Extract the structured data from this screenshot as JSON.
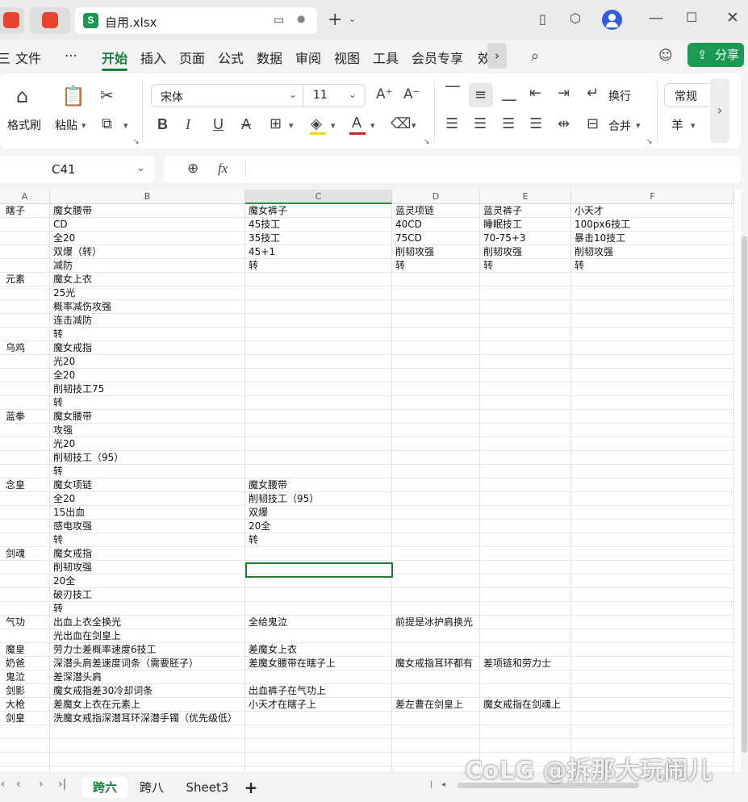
{
  "window": {
    "file_tab_title": "自用.xlsx",
    "sheet_icon_letter": "S"
  },
  "menu": {
    "items": [
      "三",
      "文件",
      "⋯",
      "开始",
      "插入",
      "页面",
      "公式",
      "数据",
      "审阅",
      "视图",
      "工具",
      "会员专享",
      "效"
    ],
    "active": "开始",
    "share_label": "分享"
  },
  "ribbon": {
    "format_painter": "格式刷",
    "paste": "粘贴",
    "font_name": "宋体",
    "font_size": "11",
    "wrap": "换行",
    "merge": "合并",
    "number_format": "常规",
    "currency": "羊"
  },
  "formula_bar": {
    "cell_ref": "C41",
    "fx": "fx",
    "content": ""
  },
  "grid": {
    "columns": [
      "A",
      "B",
      "C",
      "D",
      "E",
      "F"
    ],
    "selected_column": "C",
    "rows": [
      [
        "瞎子",
        "魔女腰带",
        "魔女裤子",
        "蓝灵项链",
        "蓝灵裤子",
        "小天才"
      ],
      [
        "",
        "CD",
        "45技工",
        "40CD",
        "睡眠技工",
        "100px6技工"
      ],
      [
        "",
        "全20",
        "35技工",
        "75CD",
        "70-75+3",
        "暴击10技工"
      ],
      [
        "",
        "双爆（转）",
        "45+1",
        "削韧攻强",
        "削韧攻强",
        "削韧攻强"
      ],
      [
        "",
        "减防",
        "转",
        "转",
        "转",
        "转"
      ],
      [
        "元素",
        "魔女上衣",
        "",
        "",
        "",
        ""
      ],
      [
        "",
        "25光",
        "",
        "",
        "",
        ""
      ],
      [
        "",
        "概率减伤攻强",
        "",
        "",
        "",
        ""
      ],
      [
        "",
        "连击减防",
        "",
        "",
        "",
        ""
      ],
      [
        "",
        "转",
        "",
        "",
        "",
        ""
      ],
      [
        "乌鸡",
        "魔女戒指",
        "",
        "",
        "",
        ""
      ],
      [
        "",
        "光20",
        "",
        "",
        "",
        ""
      ],
      [
        "",
        "全20",
        "",
        "",
        "",
        ""
      ],
      [
        "",
        "削韧技工75",
        "",
        "",
        "",
        ""
      ],
      [
        "",
        "转",
        "",
        "",
        "",
        ""
      ],
      [
        "蓝拳",
        "魔女腰带",
        "",
        "",
        "",
        ""
      ],
      [
        "",
        "攻强",
        "",
        "",
        "",
        ""
      ],
      [
        "",
        "光20",
        "",
        "",
        "",
        ""
      ],
      [
        "",
        "削韧技工（95）",
        "",
        "",
        "",
        ""
      ],
      [
        "",
        "转",
        "",
        "",
        "",
        ""
      ],
      [
        "念皇",
        "魔女项链",
        "魔女腰带",
        "",
        "",
        ""
      ],
      [
        "",
        "全20",
        "削韧技工（95）",
        "",
        "",
        ""
      ],
      [
        "",
        "15出血",
        "双爆",
        "",
        "",
        ""
      ],
      [
        "",
        "感电攻强",
        "20全",
        "",
        "",
        ""
      ],
      [
        "",
        "转",
        "转",
        "",
        "",
        ""
      ],
      [
        "剑魂",
        "魔女戒指",
        "",
        "",
        "",
        ""
      ],
      [
        "",
        "削韧攻强",
        "",
        "",
        "",
        ""
      ],
      [
        "",
        "20全",
        "",
        "",
        "",
        ""
      ],
      [
        "",
        "破刃技工",
        "",
        "",
        "",
        ""
      ],
      [
        "",
        "转",
        "",
        "",
        "",
        ""
      ],
      [
        "气功",
        "出血上衣全换光",
        "全给鬼泣",
        "前提是冰护肩换光",
        "",
        ""
      ],
      [
        "",
        "光出血在剑皇上",
        "",
        "",
        "",
        ""
      ],
      [
        "魔皇",
        "劳力士差概率速度6技工",
        "差魔女上衣",
        "",
        "",
        ""
      ],
      [
        "奶爸",
        "深潜头肩差速度词条（需要胚子）",
        "差魔女腰带在瞎子上",
        "魔女戒指耳环都有",
        "差项链和劳力士",
        ""
      ],
      [
        "鬼泣",
        "差深潜头肩",
        "",
        "",
        "",
        ""
      ],
      [
        "剑影",
        "魔女戒指差30冷却词条",
        "出血裤子在气功上",
        "",
        "",
        ""
      ],
      [
        "大枪",
        "差魔女上衣在元素上",
        "小天才在瞎子上",
        "差左曹在剑皇上",
        "魔女戒指在剑魂上",
        ""
      ],
      [
        "剑皇",
        "洗魔女戒指深潜耳环深潜手镯（优先级低）",
        "",
        "",
        "",
        ""
      ],
      [
        "",
        "",
        "",
        "",
        "",
        ""
      ],
      [
        "",
        "",
        "",
        "",
        "",
        ""
      ],
      [
        "",
        "",
        "",
        "",
        "",
        ""
      ]
    ]
  },
  "sheets": {
    "tabs": [
      "跨六",
      "跨八",
      "Sheet3"
    ],
    "active": "跨六",
    "add_label": "+"
  },
  "watermark": "CoLG @拆那大玩闹儿"
}
